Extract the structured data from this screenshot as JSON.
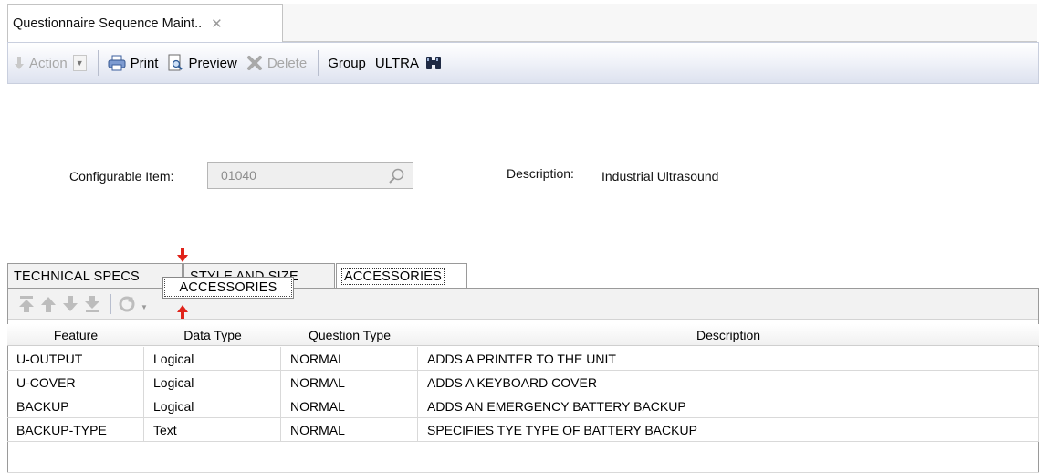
{
  "document_tab": {
    "title": "Questionnaire Sequence Maint..",
    "close_glyph": "✕"
  },
  "toolbar": {
    "action_label": "Action",
    "print_label": "Print",
    "preview_label": "Preview",
    "delete_label": "Delete",
    "group_label": "Group",
    "group_value": "ULTRA"
  },
  "form": {
    "item_label": "Configurable Item:",
    "item_value": "01040",
    "description_label": "Description:",
    "description_value": "Industrial Ultrasound"
  },
  "tabs": [
    {
      "label": "TECHNICAL SPECS"
    },
    {
      "label": "STYLE AND SIZE"
    },
    {
      "label": "ACCESSORIES"
    }
  ],
  "drag_ghost_label": "ACCESSORIES",
  "grid": {
    "columns": [
      "Feature",
      "Data Type",
      "Question Type",
      "Description"
    ],
    "rows": [
      [
        "U-OUTPUT",
        "Logical",
        "NORMAL",
        "ADDS A PRINTER TO THE UNIT"
      ],
      [
        "U-COVER",
        "Logical",
        "NORMAL",
        "ADDS A KEYBOARD COVER"
      ],
      [
        "BACKUP",
        "Logical",
        "NORMAL",
        "ADDS AN EMERGENCY BATTERY BACKUP"
      ],
      [
        "BACKUP-TYPE",
        "Text",
        "NORMAL",
        "SPECIFIES TYE TYPE OF BATTERY BACKUP"
      ]
    ]
  },
  "colors": {
    "drag_marker": "#e0231a",
    "toolbar_gradient_end": "#dde2ef"
  }
}
